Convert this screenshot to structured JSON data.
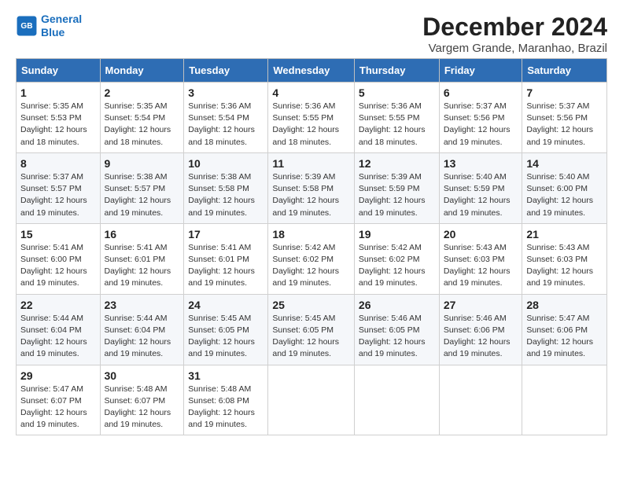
{
  "logo": {
    "line1": "General",
    "line2": "Blue"
  },
  "title": "December 2024",
  "subtitle": "Vargem Grande, Maranhao, Brazil",
  "headers": [
    "Sunday",
    "Monday",
    "Tuesday",
    "Wednesday",
    "Thursday",
    "Friday",
    "Saturday"
  ],
  "weeks": [
    [
      {
        "day": "1",
        "info": "Sunrise: 5:35 AM\nSunset: 5:53 PM\nDaylight: 12 hours\nand 18 minutes."
      },
      {
        "day": "2",
        "info": "Sunrise: 5:35 AM\nSunset: 5:54 PM\nDaylight: 12 hours\nand 18 minutes."
      },
      {
        "day": "3",
        "info": "Sunrise: 5:36 AM\nSunset: 5:54 PM\nDaylight: 12 hours\nand 18 minutes."
      },
      {
        "day": "4",
        "info": "Sunrise: 5:36 AM\nSunset: 5:55 PM\nDaylight: 12 hours\nand 18 minutes."
      },
      {
        "day": "5",
        "info": "Sunrise: 5:36 AM\nSunset: 5:55 PM\nDaylight: 12 hours\nand 18 minutes."
      },
      {
        "day": "6",
        "info": "Sunrise: 5:37 AM\nSunset: 5:56 PM\nDaylight: 12 hours\nand 19 minutes."
      },
      {
        "day": "7",
        "info": "Sunrise: 5:37 AM\nSunset: 5:56 PM\nDaylight: 12 hours\nand 19 minutes."
      }
    ],
    [
      {
        "day": "8",
        "info": "Sunrise: 5:37 AM\nSunset: 5:57 PM\nDaylight: 12 hours\nand 19 minutes."
      },
      {
        "day": "9",
        "info": "Sunrise: 5:38 AM\nSunset: 5:57 PM\nDaylight: 12 hours\nand 19 minutes."
      },
      {
        "day": "10",
        "info": "Sunrise: 5:38 AM\nSunset: 5:58 PM\nDaylight: 12 hours\nand 19 minutes."
      },
      {
        "day": "11",
        "info": "Sunrise: 5:39 AM\nSunset: 5:58 PM\nDaylight: 12 hours\nand 19 minutes."
      },
      {
        "day": "12",
        "info": "Sunrise: 5:39 AM\nSunset: 5:59 PM\nDaylight: 12 hours\nand 19 minutes."
      },
      {
        "day": "13",
        "info": "Sunrise: 5:40 AM\nSunset: 5:59 PM\nDaylight: 12 hours\nand 19 minutes."
      },
      {
        "day": "14",
        "info": "Sunrise: 5:40 AM\nSunset: 6:00 PM\nDaylight: 12 hours\nand 19 minutes."
      }
    ],
    [
      {
        "day": "15",
        "info": "Sunrise: 5:41 AM\nSunset: 6:00 PM\nDaylight: 12 hours\nand 19 minutes."
      },
      {
        "day": "16",
        "info": "Sunrise: 5:41 AM\nSunset: 6:01 PM\nDaylight: 12 hours\nand 19 minutes."
      },
      {
        "day": "17",
        "info": "Sunrise: 5:41 AM\nSunset: 6:01 PM\nDaylight: 12 hours\nand 19 minutes."
      },
      {
        "day": "18",
        "info": "Sunrise: 5:42 AM\nSunset: 6:02 PM\nDaylight: 12 hours\nand 19 minutes."
      },
      {
        "day": "19",
        "info": "Sunrise: 5:42 AM\nSunset: 6:02 PM\nDaylight: 12 hours\nand 19 minutes."
      },
      {
        "day": "20",
        "info": "Sunrise: 5:43 AM\nSunset: 6:03 PM\nDaylight: 12 hours\nand 19 minutes."
      },
      {
        "day": "21",
        "info": "Sunrise: 5:43 AM\nSunset: 6:03 PM\nDaylight: 12 hours\nand 19 minutes."
      }
    ],
    [
      {
        "day": "22",
        "info": "Sunrise: 5:44 AM\nSunset: 6:04 PM\nDaylight: 12 hours\nand 19 minutes."
      },
      {
        "day": "23",
        "info": "Sunrise: 5:44 AM\nSunset: 6:04 PM\nDaylight: 12 hours\nand 19 minutes."
      },
      {
        "day": "24",
        "info": "Sunrise: 5:45 AM\nSunset: 6:05 PM\nDaylight: 12 hours\nand 19 minutes."
      },
      {
        "day": "25",
        "info": "Sunrise: 5:45 AM\nSunset: 6:05 PM\nDaylight: 12 hours\nand 19 minutes."
      },
      {
        "day": "26",
        "info": "Sunrise: 5:46 AM\nSunset: 6:05 PM\nDaylight: 12 hours\nand 19 minutes."
      },
      {
        "day": "27",
        "info": "Sunrise: 5:46 AM\nSunset: 6:06 PM\nDaylight: 12 hours\nand 19 minutes."
      },
      {
        "day": "28",
        "info": "Sunrise: 5:47 AM\nSunset: 6:06 PM\nDaylight: 12 hours\nand 19 minutes."
      }
    ],
    [
      {
        "day": "29",
        "info": "Sunrise: 5:47 AM\nSunset: 6:07 PM\nDaylight: 12 hours\nand 19 minutes."
      },
      {
        "day": "30",
        "info": "Sunrise: 5:48 AM\nSunset: 6:07 PM\nDaylight: 12 hours\nand 19 minutes."
      },
      {
        "day": "31",
        "info": "Sunrise: 5:48 AM\nSunset: 6:08 PM\nDaylight: 12 hours\nand 19 minutes."
      },
      {
        "day": "",
        "info": ""
      },
      {
        "day": "",
        "info": ""
      },
      {
        "day": "",
        "info": ""
      },
      {
        "day": "",
        "info": ""
      }
    ]
  ]
}
